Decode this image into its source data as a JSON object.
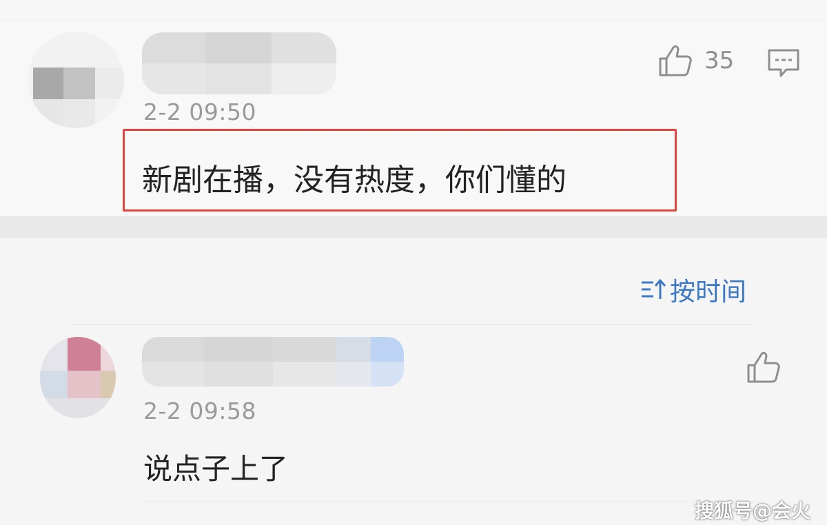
{
  "top_comment": {
    "timestamp": "2-2 09:50",
    "like_count": "35",
    "text": "新剧在播，没有热度，你们懂的"
  },
  "sort": {
    "label": "按时间"
  },
  "reply": {
    "timestamp": "2-2 09:58",
    "text": "说点子上了"
  },
  "watermark": "搜狐号@会火",
  "colors": {
    "highlight_border": "#e0443f",
    "link_blue": "#3d78c5",
    "meta_gray": "#9a9a9a"
  }
}
